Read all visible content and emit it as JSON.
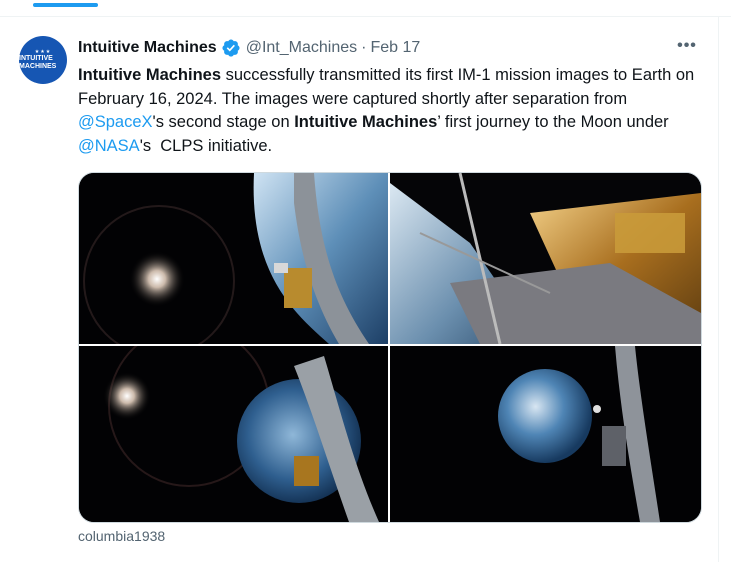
{
  "tweet": {
    "author_name": "Intuitive Machines",
    "author_handle": "@Int_Machines",
    "separator": "·",
    "date": "Feb 17",
    "more_label": "•••",
    "avatar_text": "INTUITIVE MACHINES",
    "text_segments": [
      {
        "text": "Intuitive Machines",
        "style": "bold"
      },
      {
        "text": " successfully transmitted its first IM-1 mission images to Earth on February 16, 2024. The images were captured shortly after separation from ",
        "style": "plain"
      },
      {
        "text": "@SpaceX",
        "style": "link"
      },
      {
        "text": "'s second stage on ",
        "style": "plain"
      },
      {
        "text": "Intuitive Machines",
        "style": "bold"
      },
      {
        "text": "’ first journey to the Moon under ",
        "style": "plain"
      },
      {
        "text": "@NASA",
        "style": "link"
      },
      {
        "text": "'s  CLPS initiative.",
        "style": "plain"
      }
    ],
    "media": [
      {
        "name": "media-image-1",
        "subject": "lander leg with Earth limb and sun"
      },
      {
        "name": "media-image-2",
        "subject": "gold foil lander close-up over Earth"
      },
      {
        "name": "media-image-3",
        "subject": "Earth with lander strut and sun"
      },
      {
        "name": "media-image-4",
        "subject": "distant Earth with lander strut"
      }
    ],
    "image_credit": "columbia1938"
  },
  "colors": {
    "accent": "#1d9bf0",
    "text": "#0f1419",
    "secondary_text": "#536471",
    "border": "#cfd9de"
  }
}
